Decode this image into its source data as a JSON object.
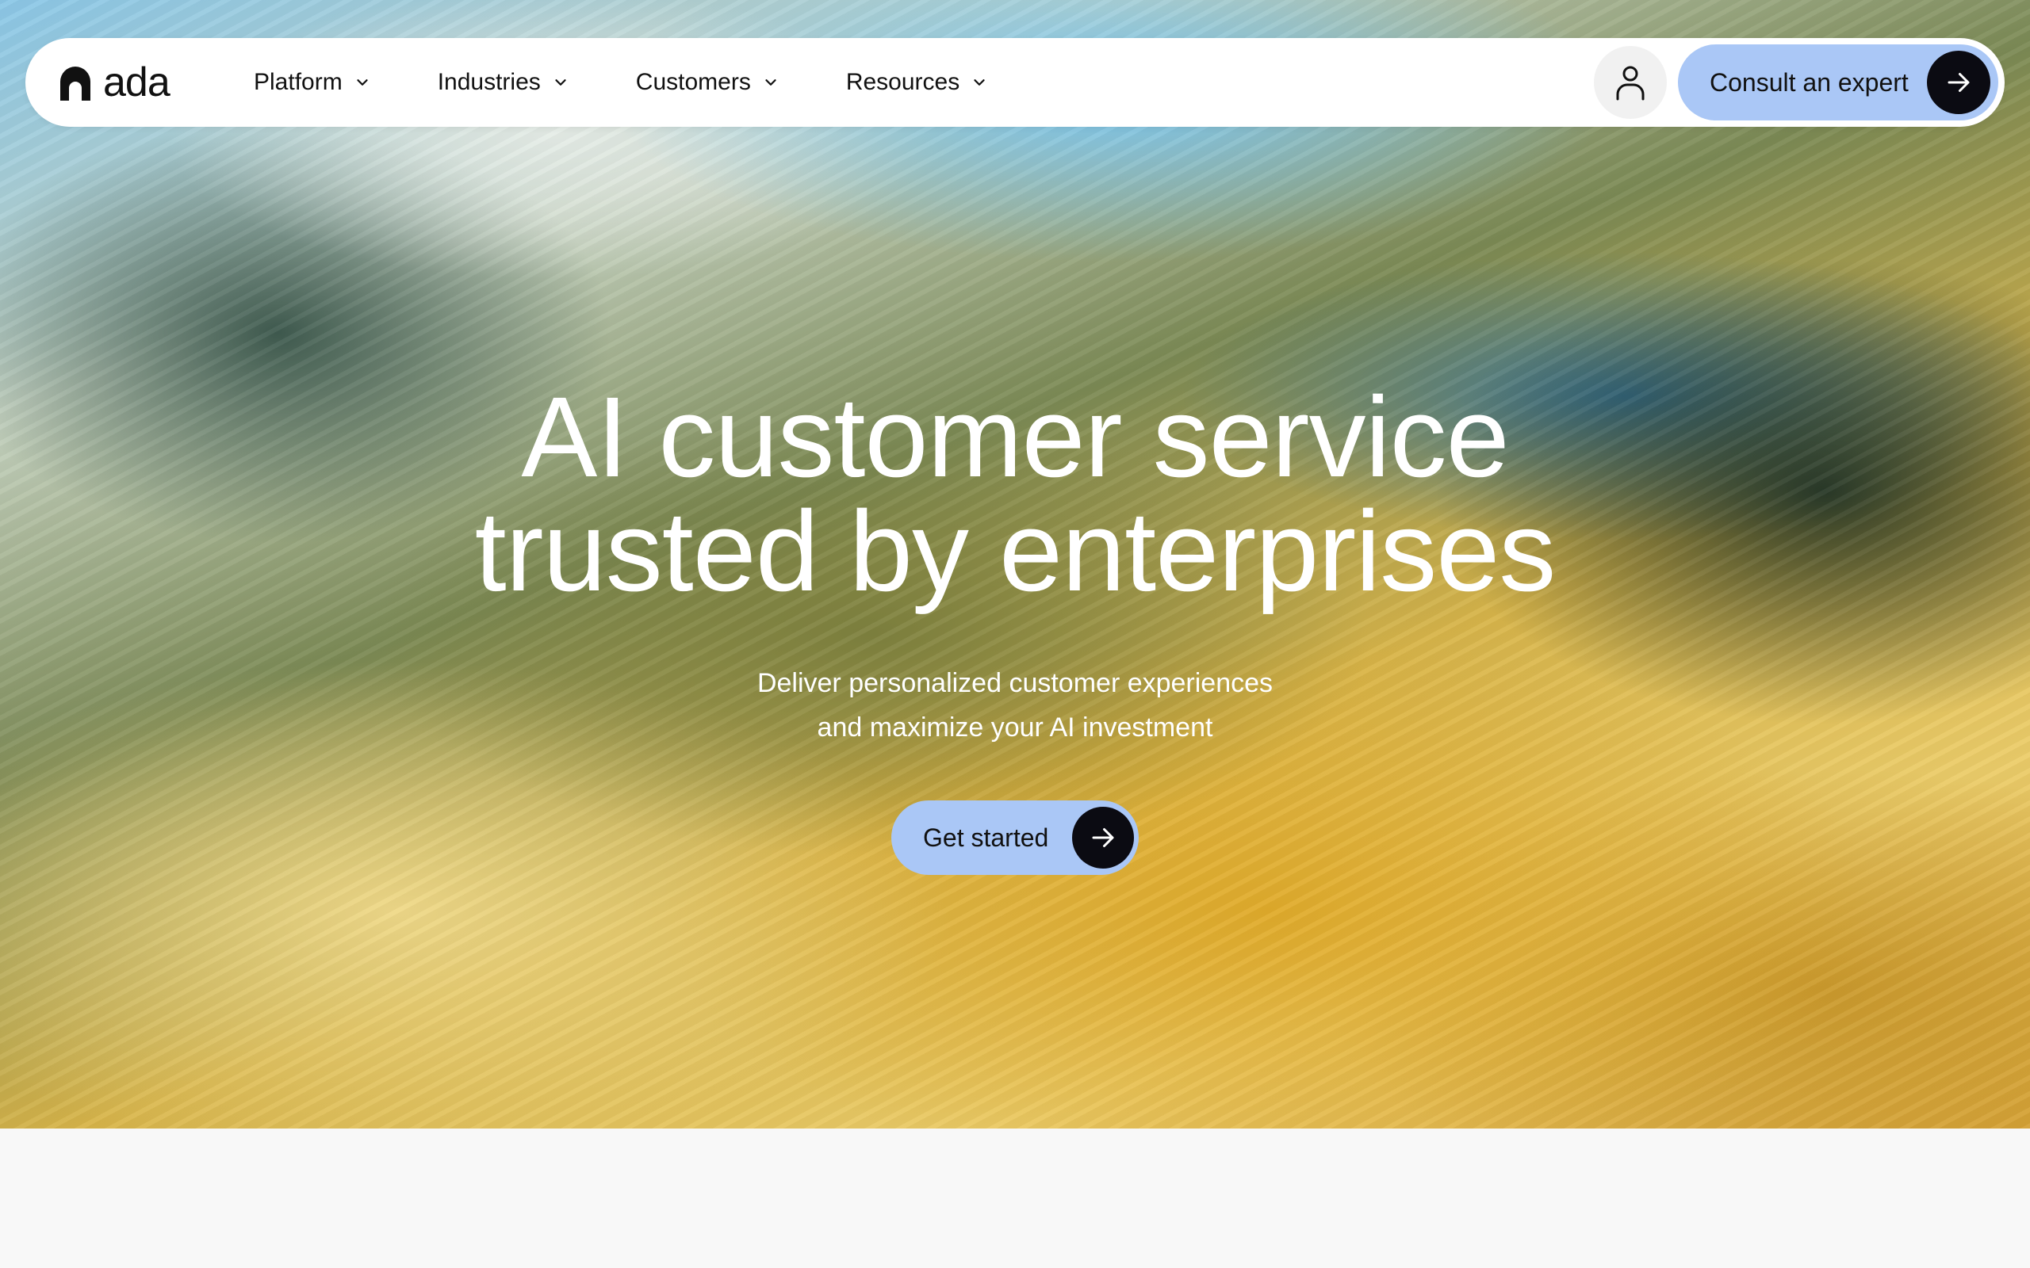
{
  "brand": {
    "name": "ada"
  },
  "nav": {
    "items": [
      {
        "label": "Platform"
      },
      {
        "label": "Industries"
      },
      {
        "label": "Customers"
      },
      {
        "label": "Resources"
      }
    ],
    "account_icon": "user-icon",
    "cta_label": "Consult an expert"
  },
  "hero": {
    "headline_line1": "AI customer service",
    "headline_line2": "trusted by enterprises",
    "sub_line1": "Deliver personalized customer experiences",
    "sub_line2": "and maximize your AI investment",
    "cta_label": "Get started"
  },
  "colors": {
    "accent": "#aac7f6",
    "dark": "#0b0b12",
    "headline": "#ffffff"
  }
}
